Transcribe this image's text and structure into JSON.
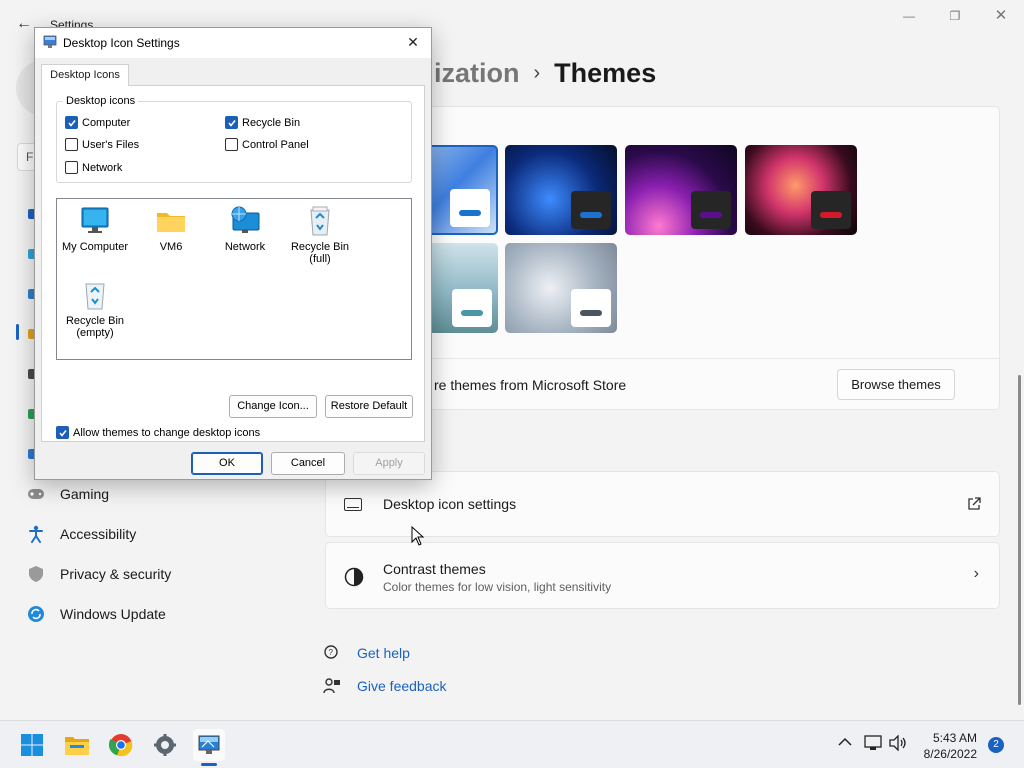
{
  "settings": {
    "window_title": "Settings",
    "breadcrumb": {
      "parent": "ization",
      "separator": "›",
      "current": "Themes"
    },
    "search_char": "F",
    "nav_items": [
      {
        "label": "Gaming",
        "icon": "gaming-controller-icon"
      },
      {
        "label": "Accessibility",
        "icon": "accessibility-person-icon"
      },
      {
        "label": "Privacy & security",
        "icon": "shield-icon"
      },
      {
        "label": "Windows Update",
        "icon": "windows-update-icon"
      }
    ],
    "themes": [
      {
        "name": "windows-light-bloom",
        "bar_color": "#1673cf",
        "chip_color": "#ffffff"
      },
      {
        "name": "windows-dark-bloom",
        "bar_color": "#1a73d1",
        "chip_color": "#262626"
      },
      {
        "name": "glow",
        "bar_color": "#5c0e8f",
        "chip_color": "#262626"
      },
      {
        "name": "captured-motion",
        "bar_color": "#d41a2a",
        "chip_color": "#262626"
      },
      {
        "name": "sunrise",
        "bar_color": "#4b97a8",
        "chip_color": "#ffffff"
      },
      {
        "name": "flow",
        "bar_color": "#4b5560",
        "chip_color": "#ffffff"
      }
    ],
    "browse_text": "re themes from Microsoft Store",
    "browse_button": "Browse themes",
    "desktop_icon_settings": {
      "title": "Desktop icon settings"
    },
    "contrast_themes": {
      "title": "Contrast themes",
      "subtitle": "Color themes for low vision, light sensitivity"
    },
    "links": {
      "help": "Get help",
      "feedback": "Give feedback"
    }
  },
  "dialog": {
    "title": "Desktop Icon Settings",
    "tab": "Desktop Icons",
    "group_label": "Desktop icons",
    "checkboxes": [
      {
        "label": "Computer",
        "checked": true
      },
      {
        "label": "Recycle Bin",
        "checked": true
      },
      {
        "label": "User's Files",
        "checked": false
      },
      {
        "label": "Control Panel",
        "checked": false
      },
      {
        "label": "Network",
        "checked": false
      }
    ],
    "icons": [
      {
        "label": "My Computer",
        "icon": "monitor-icon"
      },
      {
        "label": "VM6",
        "icon": "folder-icon"
      },
      {
        "label": "Network",
        "icon": "network-globe-icon"
      },
      {
        "label": "Recycle Bin (full)",
        "icon": "recycle-bin-full-icon"
      },
      {
        "label": "Recycle Bin (empty)",
        "icon": "recycle-bin-empty-icon"
      }
    ],
    "change_icon": "Change Icon...",
    "restore_default": "Restore Default",
    "allow_themes": "Allow themes to change desktop icons",
    "ok": "OK",
    "cancel": "Cancel",
    "apply": "Apply"
  },
  "taskbar": {
    "time": "5:43 AM",
    "date": "8/26/2022",
    "notifications": "2",
    "apps": [
      "start-icon",
      "file-explorer-icon",
      "chrome-icon",
      "settings-gear-icon",
      "desktop-icon-settings-app-icon"
    ]
  }
}
